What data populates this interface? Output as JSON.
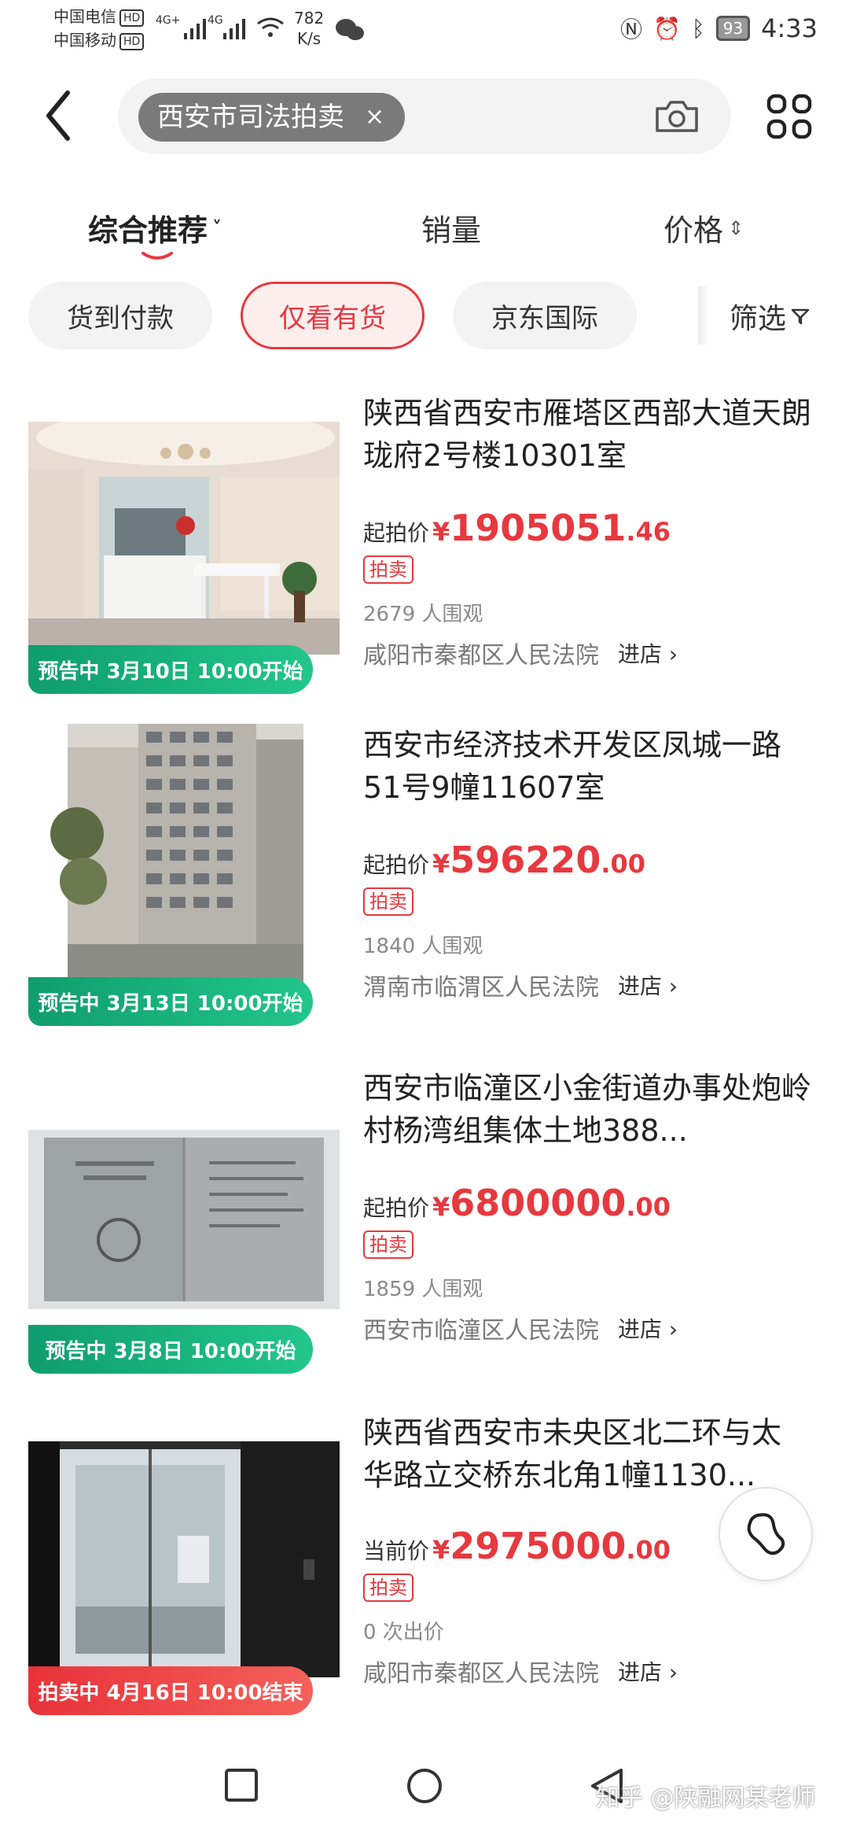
{
  "status_bar": {
    "carrier1": "中国电信",
    "carrier2": "中国移动",
    "hd": "HD",
    "net1": "4G+",
    "net2": "4G",
    "speed_value": "782",
    "speed_unit": "K/s",
    "battery": "93",
    "time": "4:33"
  },
  "search": {
    "query": "西安市司法拍卖",
    "clear": "×"
  },
  "sort_tabs": [
    {
      "label": "综合推荐",
      "arrow": "˅"
    },
    {
      "label": "销量"
    },
    {
      "label": "价格",
      "arrow": "⇕"
    }
  ],
  "filters": [
    {
      "label": "货到付款"
    },
    {
      "label": "仅看有货"
    },
    {
      "label": "京东国际"
    }
  ],
  "filter_button": "筛选",
  "listings": [
    {
      "title": "陕西省西安市雁塔区西部大道天朗珑府2号楼10301室",
      "price_label": "起拍价",
      "price_int": "1905051",
      "price_dec": ".46",
      "tag": "拍卖",
      "views": "2679 人围观",
      "court": "咸阳市秦都区人民法院",
      "shop": "进店",
      "badge": "预告中 3月10日 10:00开始",
      "badge_color": "#17b07a"
    },
    {
      "title": "西安市经济技术开发区凤城一路51号9幢11607室",
      "price_label": "起拍价",
      "price_int": "596220",
      "price_dec": ".00",
      "tag": "拍卖",
      "views": "1840 人围观",
      "court": "渭南市临渭区人民法院",
      "shop": "进店",
      "badge": "预告中 3月13日 10:00开始",
      "badge_color": "#17b07a"
    },
    {
      "title": "西安市临潼区小金街道办事处炮岭村杨湾组集体土地388...",
      "price_label": "起拍价",
      "price_int": "6800000",
      "price_dec": ".00",
      "tag": "拍卖",
      "views": "1859 人围观",
      "court": "西安市临潼区人民法院",
      "shop": "进店",
      "badge": "预告中 3月8日 10:00开始",
      "badge_color": "#17b07a"
    },
    {
      "title": "陕西省西安市未央区北二环与太华路立交桥东北角1幢1130...",
      "price_label": "当前价",
      "price_int": "2975000",
      "price_dec": ".00",
      "tag": "拍卖",
      "views": "0 次出价",
      "court": "咸阳市秦都区人民法院",
      "shop": "进店",
      "badge": "拍卖中 4月16日 10:00结束",
      "badge_color": "#ec4147"
    }
  ],
  "currency": "¥",
  "watermark": "知乎 @陕融网某老师"
}
